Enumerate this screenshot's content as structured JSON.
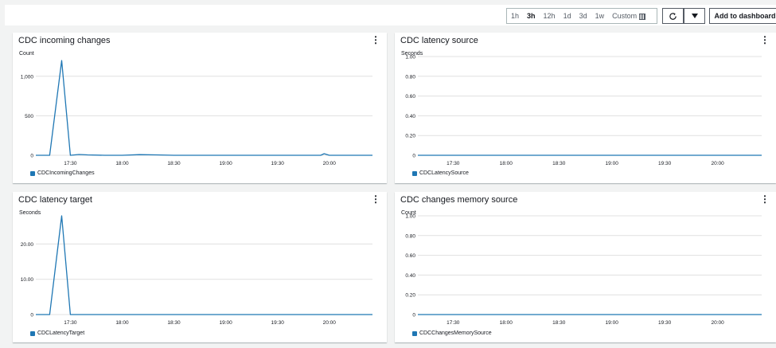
{
  "toolbar": {
    "ranges": [
      "1h",
      "3h",
      "12h",
      "1d",
      "3d",
      "1w",
      "Custom"
    ],
    "active_range": "3h",
    "add_label": "Add to dashboard",
    "refresh_icon": "refresh-icon",
    "dropdown_icon": "caret-down-icon",
    "calendar_icon": "calendar-icon"
  },
  "panels": [
    {
      "title": "CDC incoming changes",
      "unit": "Count",
      "legend": "CDCIncomingChanges"
    },
    {
      "title": "CDC latency source",
      "unit": "Seconds",
      "legend": "CDCLatencySource"
    },
    {
      "title": "CDC latency target",
      "unit": "Seconds",
      "legend": "CDCLatencyTarget"
    },
    {
      "title": "CDC changes memory source",
      "unit": "Count",
      "legend": "CDCChangesMemorySource"
    }
  ],
  "colors": {
    "series": "#1f77b4",
    "grid": "#e0e0e0"
  },
  "chart_data": [
    {
      "type": "line",
      "title": "CDC incoming changes",
      "ylabel": "Count",
      "x_ticks": [
        "17:30",
        "18:00",
        "18:30",
        "19:00",
        "19:30",
        "20:00"
      ],
      "y_ticks": [
        "0",
        "500",
        "1,000"
      ],
      "ylim": [
        0,
        1250
      ],
      "xlim": [
        "17:10",
        "20:25"
      ],
      "series": [
        {
          "name": "CDCIncomingChanges",
          "x": [
            "17:10",
            "17:18",
            "17:25",
            "17:30",
            "17:35",
            "17:40",
            "17:50",
            "18:00",
            "18:10",
            "18:20",
            "18:30",
            "18:45",
            "19:00",
            "19:15",
            "19:30",
            "19:45",
            "19:55",
            "19:57",
            "20:00",
            "20:15",
            "20:25"
          ],
          "values": [
            0,
            0,
            1200,
            0,
            10,
            5,
            0,
            0,
            8,
            5,
            0,
            0,
            0,
            0,
            0,
            0,
            0,
            20,
            0,
            0,
            0
          ]
        }
      ],
      "legend": "bottom-left",
      "grid": true
    },
    {
      "type": "line",
      "title": "CDC latency source",
      "ylabel": "Seconds",
      "x_ticks": [
        "17:30",
        "18:00",
        "18:30",
        "19:00",
        "19:30",
        "20:00"
      ],
      "y_ticks": [
        "0",
        "0.20",
        "0.40",
        "0.60",
        "0.80",
        "1.00"
      ],
      "ylim": [
        0,
        1
      ],
      "xlim": [
        "17:10",
        "20:25"
      ],
      "series": [
        {
          "name": "CDCLatencySource",
          "x": [
            "17:10",
            "20:25"
          ],
          "values": [
            0,
            0
          ]
        }
      ],
      "legend": "bottom-left",
      "grid": true
    },
    {
      "type": "line",
      "title": "CDC latency target",
      "ylabel": "Seconds",
      "x_ticks": [
        "17:30",
        "18:00",
        "18:30",
        "19:00",
        "19:30",
        "20:00"
      ],
      "y_ticks": [
        "0",
        "10.00",
        "20.00"
      ],
      "ylim": [
        0,
        28
      ],
      "xlim": [
        "17:10",
        "20:25"
      ],
      "series": [
        {
          "name": "CDCLatencyTarget",
          "x": [
            "17:10",
            "17:18",
            "17:25",
            "17:30",
            "20:25"
          ],
          "values": [
            0,
            0,
            28,
            0,
            0
          ]
        }
      ],
      "legend": "bottom-left",
      "grid": true
    },
    {
      "type": "line",
      "title": "CDC changes memory source",
      "ylabel": "Count",
      "x_ticks": [
        "17:30",
        "18:00",
        "18:30",
        "19:00",
        "19:30",
        "20:00"
      ],
      "y_ticks": [
        "0",
        "0.20",
        "0.40",
        "0.60",
        "0.80",
        "1.00"
      ],
      "ylim": [
        0,
        1
      ],
      "xlim": [
        "17:10",
        "20:25"
      ],
      "series": [
        {
          "name": "CDCChangesMemorySource",
          "x": [
            "17:10",
            "20:25"
          ],
          "values": [
            0,
            0
          ]
        }
      ],
      "legend": "bottom-left",
      "grid": true
    }
  ]
}
